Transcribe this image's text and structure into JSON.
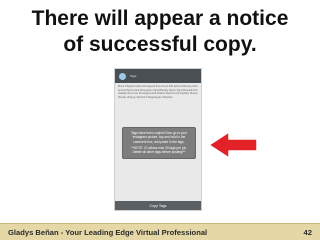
{
  "slide": {
    "title_line1": "There will appear a notice",
    "title_line2": "of successful copy.",
    "footer_text": "Gladys Beñan - Your Leading Edge Virtual Professional",
    "page_number": "42"
  },
  "phone": {
    "app_name": "Tags",
    "tags_text": "#love #TagsForLikes #instagood #me #cute #tbt #photooftheday #instamood #iphonesia #tweegram #picoftheday #igers #girl #beautiful #instadaily #summer #instagramhub #follow #iphoneonly #igdaily #bestoftheday #happy #picstitch #tagstagram #fashion",
    "toast_line1": "Tags have been copied! Now go to your Instagram picture, tap and hold in the comment box, and paste in the tags.",
    "toast_line2": "**NOTE: IG allows max 30 tags per pic. Delete all other tags before posting!**",
    "copy_button": "Copy Tags"
  },
  "colors": {
    "footer_bg": "#e5d8a6",
    "arrow": "#e32227"
  }
}
